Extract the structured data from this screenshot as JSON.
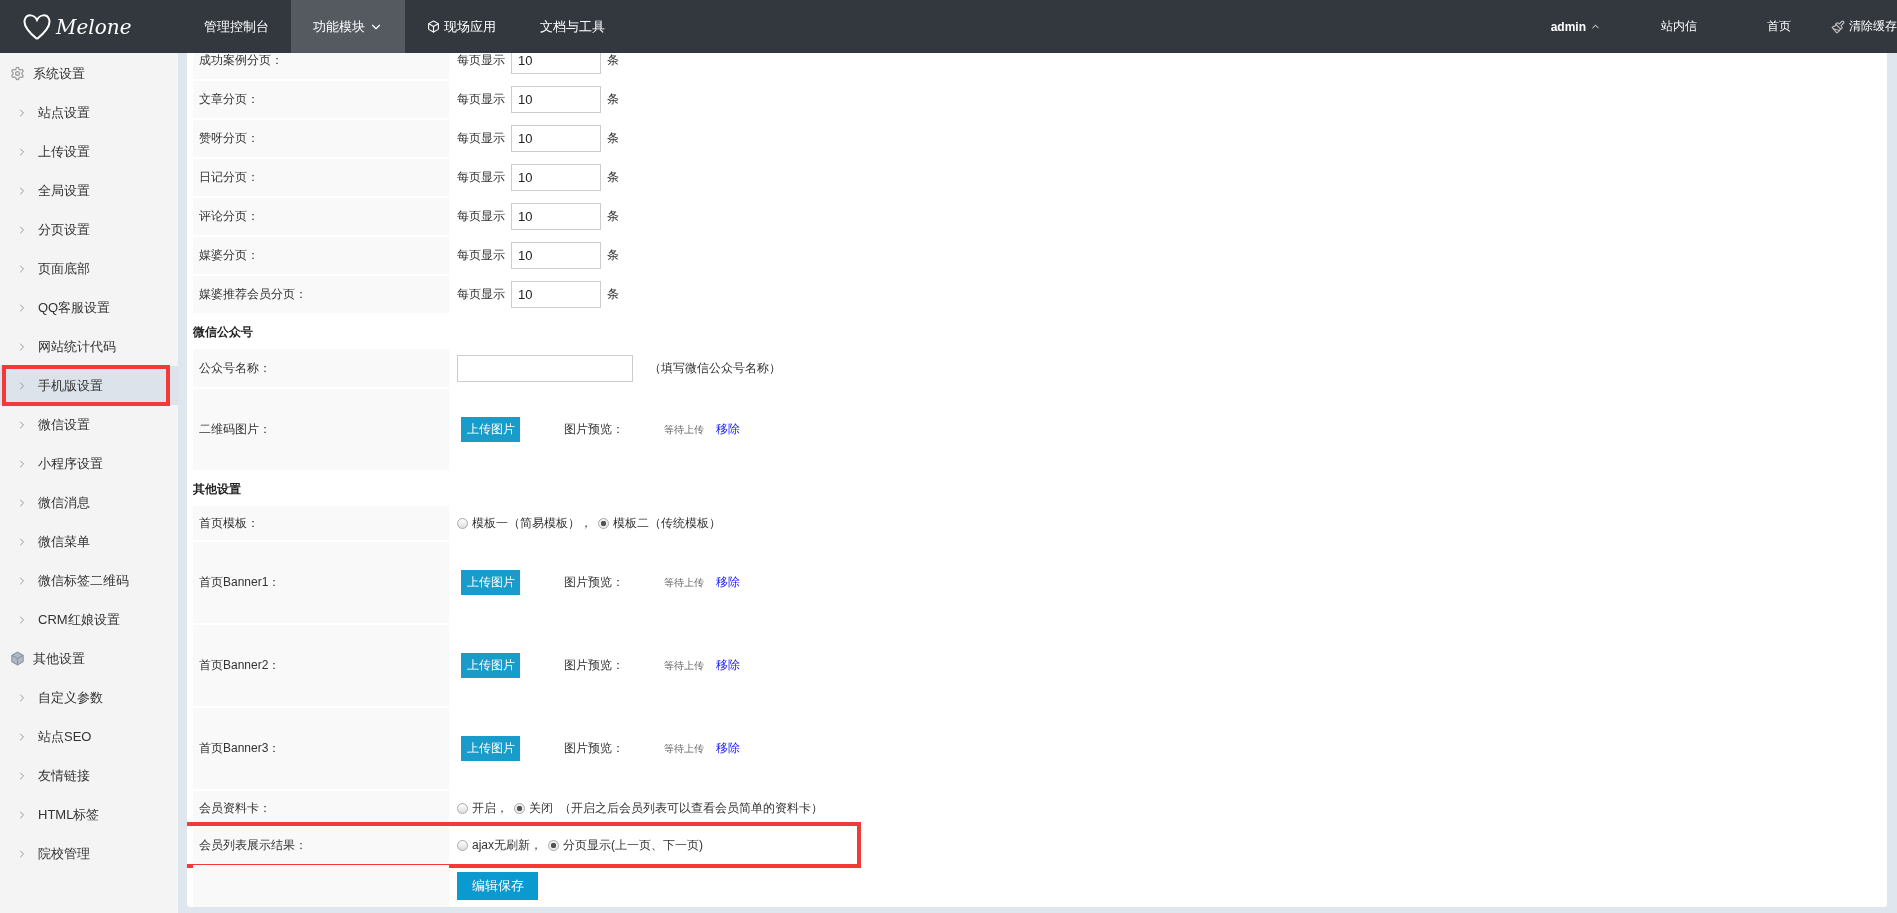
{
  "nav": {
    "logo": "Melone",
    "items": [
      {
        "label": "管理控制台",
        "selected": false,
        "kind": "plain"
      },
      {
        "label": "功能模块",
        "selected": true,
        "kind": "dropdown"
      },
      {
        "label": "现场应用",
        "selected": false,
        "kind": "app"
      },
      {
        "label": "文档与工具",
        "selected": false,
        "kind": "plain"
      }
    ],
    "right": [
      {
        "label": "admin",
        "kind": "user"
      },
      {
        "label": "站内信",
        "kind": "link"
      },
      {
        "label": "首页",
        "kind": "link"
      },
      {
        "label": "清除缓存",
        "kind": "clean"
      }
    ]
  },
  "sidebar": {
    "groups": [
      {
        "title": "系统设置",
        "kind": "settings",
        "items": [
          {
            "label": "站点设置",
            "selected": false,
            "highlighted": false
          },
          {
            "label": "上传设置",
            "selected": false,
            "highlighted": false
          },
          {
            "label": "全局设置",
            "selected": false,
            "highlighted": false
          },
          {
            "label": "分页设置",
            "selected": false,
            "highlighted": false
          },
          {
            "label": "页面底部",
            "selected": false,
            "highlighted": false
          },
          {
            "label": "QQ客服设置",
            "selected": false,
            "highlighted": false
          },
          {
            "label": "网站统计代码",
            "selected": false,
            "highlighted": false
          },
          {
            "label": "手机版设置",
            "selected": true,
            "highlighted": true
          },
          {
            "label": "微信设置",
            "selected": false,
            "highlighted": false
          },
          {
            "label": "小程序设置",
            "selected": false,
            "highlighted": false
          },
          {
            "label": "微信消息",
            "selected": false,
            "highlighted": false
          },
          {
            "label": "微信菜单",
            "selected": false,
            "highlighted": false
          },
          {
            "label": "微信标签二维码",
            "selected": false,
            "highlighted": false
          },
          {
            "label": "CRM红娘设置",
            "selected": false,
            "highlighted": false
          }
        ]
      },
      {
        "title": "其他设置",
        "kind": "box",
        "items": [
          {
            "label": "自定义参数",
            "selected": false,
            "highlighted": false
          },
          {
            "label": "站点SEO",
            "selected": false,
            "highlighted": false
          },
          {
            "label": "友情链接",
            "selected": false,
            "highlighted": false
          },
          {
            "label": "HTML标签",
            "selected": false,
            "highlighted": false
          },
          {
            "label": "院校管理",
            "selected": false,
            "highlighted": false
          }
        ]
      }
    ]
  },
  "form": {
    "sections": [
      {
        "rows": [
          {
            "kind": "page_size",
            "label": "成功案例分页：",
            "prefix": "每页显示",
            "value": "10",
            "unit": "条"
          },
          {
            "kind": "page_size",
            "label": "文章分页：",
            "prefix": "每页显示",
            "value": "10",
            "unit": "条"
          },
          {
            "kind": "page_size",
            "label": "赞呀分页：",
            "prefix": "每页显示",
            "value": "10",
            "unit": "条"
          },
          {
            "kind": "page_size",
            "label": "日记分页：",
            "prefix": "每页显示",
            "value": "10",
            "unit": "条"
          },
          {
            "kind": "page_size",
            "label": "评论分页：",
            "prefix": "每页显示",
            "value": "10",
            "unit": "条"
          },
          {
            "kind": "page_size",
            "label": "媒婆分页：",
            "prefix": "每页显示",
            "value": "10",
            "unit": "条"
          },
          {
            "kind": "page_size",
            "label": "媒婆推荐会员分页：",
            "prefix": "每页显示",
            "value": "10",
            "unit": "条"
          }
        ]
      },
      {
        "heading": "微信公众号",
        "rows": [
          {
            "kind": "text",
            "label": "公众号名称：",
            "hint": "（填写微信公众号名称）"
          },
          {
            "kind": "upload",
            "label": "二维码图片：",
            "button": "上传图片",
            "preview_label": "图片预览：",
            "status": "等待上传",
            "remove": "移除"
          }
        ]
      },
      {
        "heading": "其他设置",
        "rows": [
          {
            "kind": "radio",
            "label": "首页模板：",
            "highlighted": false,
            "options": [
              {
                "label": "模板一（简易模板），",
                "selected": false
              },
              {
                "label": "模板二（传统模板）",
                "selected": true
              }
            ]
          },
          {
            "kind": "upload",
            "label": "首页Banner1：",
            "button": "上传图片",
            "preview_label": "图片预览：",
            "status": "等待上传",
            "remove": "移除"
          },
          {
            "kind": "upload",
            "label": "首页Banner2：",
            "button": "上传图片",
            "preview_label": "图片预览：",
            "status": "等待上传",
            "remove": "移除"
          },
          {
            "kind": "upload",
            "label": "首页Banner3：",
            "button": "上传图片",
            "preview_label": "图片预览：",
            "status": "等待上传",
            "remove": "移除"
          },
          {
            "kind": "radio",
            "label": "会员资料卡：",
            "highlighted": false,
            "options": [
              {
                "label": "开启，",
                "selected": false
              },
              {
                "label": "关闭",
                "selected": true
              }
            ],
            "note": "（开启之后会员列表可以查看会员简单的资料卡）"
          },
          {
            "kind": "radio",
            "label": "会员列表展示结果：",
            "highlighted": true,
            "options": [
              {
                "label": "ajax无刷新，",
                "selected": false
              },
              {
                "label": "分页显示(上一页、下一页)",
                "selected": true
              }
            ]
          }
        ]
      }
    ],
    "save_button": "编辑保存"
  }
}
